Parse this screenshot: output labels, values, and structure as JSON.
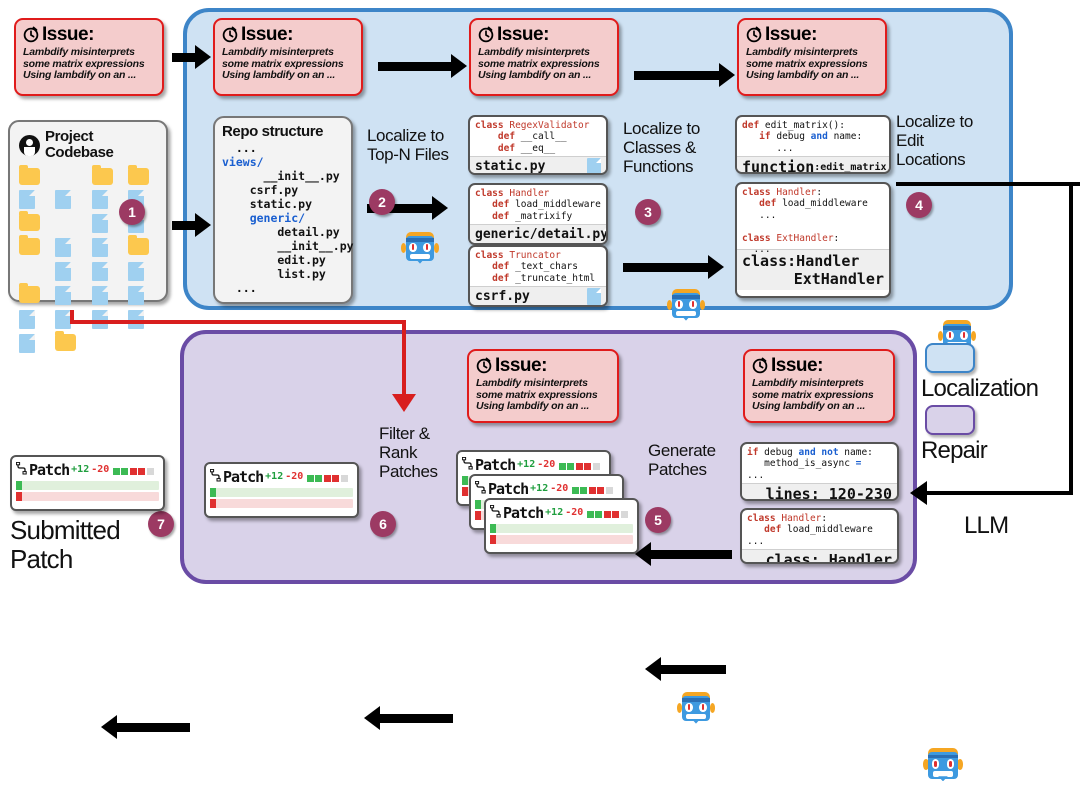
{
  "panels": {
    "localization": {
      "label": "Localization",
      "color": "#cfe2f3",
      "border": "#3d85c8"
    },
    "repair": {
      "label": "Repair",
      "color": "#d9d2e9",
      "border": "#6a4ca5"
    }
  },
  "legend": {
    "llm_label": "LLM"
  },
  "issue": {
    "title": "Issue:",
    "line1": "Lambdify misinterprets",
    "line2": "some matrix expressions",
    "line3": "Using lambdify on an ..."
  },
  "codebase": {
    "title_line1": "Project",
    "title_line2": "Codebase",
    "icons": [
      "folder",
      "blank",
      "folder",
      "folder",
      "file",
      "file",
      "file",
      "file",
      "folder",
      "blank",
      "file",
      "file",
      "folder",
      "file",
      "file",
      "folder",
      "blank",
      "file",
      "file",
      "file",
      "folder",
      "file",
      "file",
      "file",
      "file",
      "file",
      "file",
      "file",
      "file",
      "folder"
    ]
  },
  "repo": {
    "title": "Repo structure",
    "lines": [
      {
        "indent": 1,
        "text": "...",
        "kind": "plain"
      },
      {
        "indent": 0,
        "text": "views/",
        "kind": "dir"
      },
      {
        "indent": 3,
        "text": "__init__.py",
        "kind": "plain"
      },
      {
        "indent": 2,
        "text": "csrf.py",
        "kind": "plain"
      },
      {
        "indent": 2,
        "text": "static.py",
        "kind": "plain"
      },
      {
        "indent": 2,
        "text": "generic/",
        "kind": "dir"
      },
      {
        "indent": 4,
        "text": "detail.py",
        "kind": "plain"
      },
      {
        "indent": 4,
        "text": "__init__.py",
        "kind": "plain"
      },
      {
        "indent": 4,
        "text": "edit.py",
        "kind": "plain"
      },
      {
        "indent": 4,
        "text": "list.py",
        "kind": "plain"
      },
      {
        "indent": 1,
        "text": "...",
        "kind": "plain"
      }
    ]
  },
  "arrow_labels": {
    "step2": "Localize to\nTop-N Files",
    "step3": "Localize to\nClasses &\nFunctions",
    "step4": "Localize to\nEdit\nLocations",
    "step5": "Generate\nPatches",
    "step6": "Filter &\nRank\nPatches"
  },
  "steps": {
    "s1": "1",
    "s2": "2",
    "s3": "3",
    "s4": "4",
    "s5": "5",
    "s6": "6",
    "s7": "7"
  },
  "files_cards": [
    {
      "code": "class RegexValidator\n    def __call__\n    def __eq__",
      "footer": "static.py",
      "footer_align": "right"
    },
    {
      "code": "class Handler\n    def load_middleware\n    def _matrixify",
      "footer": "generic/detail.py",
      "footer_align": "left"
    },
    {
      "code": "class Truncator\n    def _text_chars\n    def _truncate_html",
      "footer": "csrf.py",
      "footer_align": "right"
    }
  ],
  "edit_cards": [
    {
      "code": "def edit_matrix():\n    if debug and name:\n       ...",
      "footer_big": "function",
      "footer_small": ":edit_matrix"
    },
    {
      "code": "class Handler:\n    def load_middleware\n    ...\n\nclass ExtHandler:\n   ...",
      "footer_big": "class:Handler",
      "footer_big2": "ExtHandler"
    }
  ],
  "repair_cards": [
    {
      "code": "if debug and not name:\n   method_is_async =\n...",
      "footer_big": "lines: 120-230"
    },
    {
      "code": "class Handler:\n    def load_middleware\n...",
      "footer_big": "class: Handler"
    }
  ],
  "patch": {
    "label": "Patch",
    "added": "+12",
    "deleted": "-20",
    "squares": [
      "#3cba54",
      "#3cba54",
      "#e03030",
      "#e03030",
      "#d8d8d8"
    ]
  },
  "submitted": {
    "line1": "Submitted",
    "line2": "Patch"
  }
}
